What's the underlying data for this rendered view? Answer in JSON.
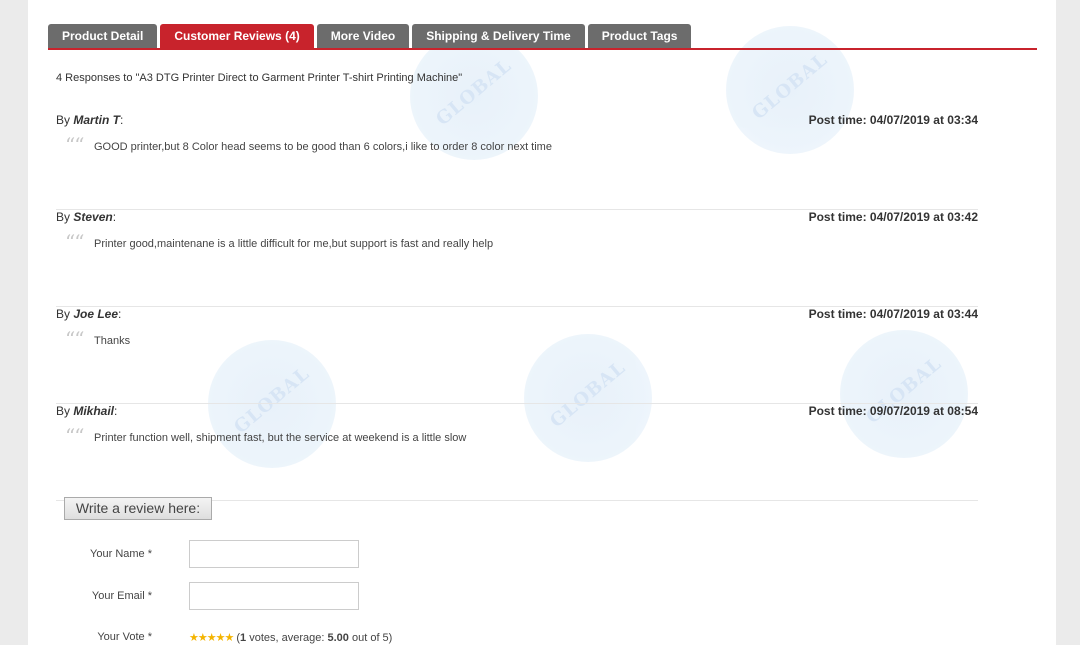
{
  "tabs": [
    {
      "label": "Product Detail",
      "active": false
    },
    {
      "label": "Customer Reviews (4)",
      "active": true
    },
    {
      "label": "More Video",
      "active": false
    },
    {
      "label": "Shipping & Delivery Time",
      "active": false
    },
    {
      "label": "Product Tags",
      "active": false
    }
  ],
  "responses_heading": "4 Responses to \"A3 DTG Printer Direct to Garment Printer T-shirt Printing Machine\"",
  "reviews": [
    {
      "by": "By ",
      "author": "Martin T",
      "colon": ":",
      "post_time": "Post time: 04/07/2019 at 03:34",
      "text": "GOOD printer,but 8 Color head seems to be good than 6 colors,i like to order 8 color next time"
    },
    {
      "by": "By ",
      "author": "Steven",
      "colon": ":",
      "post_time": "Post time: 04/07/2019 at 03:42",
      "text": "Printer good,maintenane is a little difficult for me,but support is fast and really help"
    },
    {
      "by": "By ",
      "author": "Joe Lee",
      "colon": ":",
      "post_time": "Post time: 04/07/2019 at 03:44",
      "text": "Thanks"
    },
    {
      "by": "By ",
      "author": "Mikhail",
      "colon": ":",
      "post_time": "Post time: 09/07/2019 at 08:54",
      "text": "Printer function well, shipment fast, but the service at weekend is a little slow"
    }
  ],
  "quote_icon": "quote-icon",
  "review_form": {
    "write_button": "Write a review here:",
    "name_label": "Your Name *",
    "email_label": "Your Email *",
    "vote_label": "Your Vote *",
    "name_value": "",
    "email_value": "",
    "vote": {
      "stars_glyph": "★★★★★",
      "rating": 5,
      "open_paren": "(",
      "votes_count": "1",
      "votes_text": " votes, average: ",
      "average": "5.00",
      "out_of": " out of 5)"
    }
  },
  "watermark_text": "GLOBAL",
  "colors": {
    "accent_red": "#c8232c",
    "tab_gray": "#6c6c6c",
    "star_gold": "#f4b400",
    "watermark_blue": "#d3e3f4"
  }
}
